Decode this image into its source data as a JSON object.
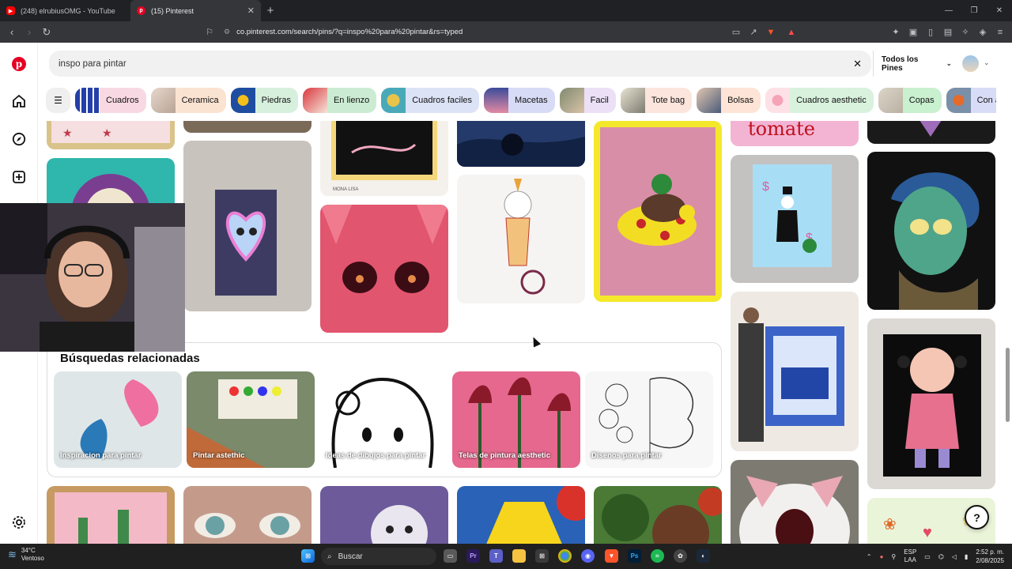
{
  "browser": {
    "tabs": [
      {
        "title": "(248) elrubiusOMG - YouTube",
        "icon": "youtube-icon",
        "color": "#ff0000"
      },
      {
        "title": "(15) Pinterest",
        "icon": "pinterest-icon",
        "color": "#e60023"
      }
    ],
    "url": "co.pinterest.com/search/pins/?q=inspo%20para%20pintar&rs=typed"
  },
  "search": {
    "query": "inspo para pintar",
    "filter_label": "Todos los Pines"
  },
  "chips": [
    {
      "label": "Cuadros",
      "bg": "#f8d9e3"
    },
    {
      "label": "Ceramica",
      "bg": "#fbe3d2"
    },
    {
      "label": "Piedras",
      "bg": "#d7f0dd"
    },
    {
      "label": "En lienzo",
      "bg": "#cbecd3"
    },
    {
      "label": "Cuadros faciles",
      "bg": "#dce3f6"
    },
    {
      "label": "Macetas",
      "bg": "#d8dbf5"
    },
    {
      "label": "Facil",
      "bg": "#ece0f6"
    },
    {
      "label": "Tote bag",
      "bg": "#fbe5dc"
    },
    {
      "label": "Bolsas",
      "bg": "#fde4d6"
    },
    {
      "label": "Cuadros aesthetic",
      "bg": "#d9f2dd"
    },
    {
      "label": "Copas",
      "bg": "#c9f0cf"
    },
    {
      "label": "Con a",
      "bg": "#d8dcf6"
    }
  ],
  "related": {
    "title": "Búsquedas relacionadas",
    "items": [
      "Inspiracion para pintar",
      "Pintar astethic",
      "Ideas de dibujos para pintar",
      "Telas de pintura aesthetic",
      "Disenos para pintar"
    ]
  },
  "pin_text": {
    "tomate": "tomate",
    "mona_lisa": "MONA LISA"
  },
  "taskbar": {
    "temperature": "34°C",
    "weather": "Ventoso",
    "search_label": "Buscar",
    "language": "ESP",
    "language_sub": "LAA",
    "time": "2:52 p. m.",
    "date": "2/08/2025"
  }
}
